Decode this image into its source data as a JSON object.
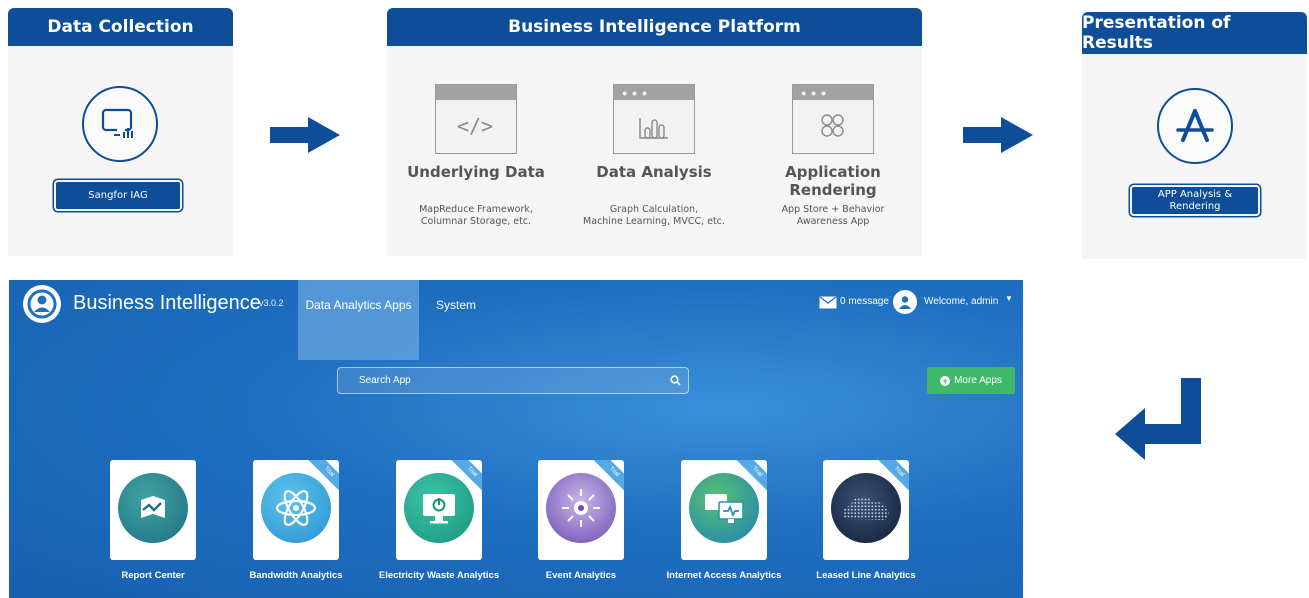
{
  "collection": {
    "title": "Data Collection",
    "button": "Sangfor IAG"
  },
  "platform": {
    "title": "Business Intelligence Platform",
    "columns": [
      {
        "title": "Underlying Data",
        "desc1": "MapReduce Framework,",
        "desc2": "Columnar Storage, etc.",
        "icon": "code-window-icon"
      },
      {
        "title": "Data Analysis",
        "desc1": "Graph Calculation,",
        "desc2": "Machine Learning, MVCC, etc.",
        "icon": "chart-window-icon"
      },
      {
        "title": "Application Rendering",
        "desc1": "App Store + Behavior",
        "desc2": "Awareness App",
        "icon": "apps-window-icon"
      }
    ]
  },
  "presentation": {
    "title": "Presentation of Results",
    "button_line1": "APP Analysis &",
    "button_line2": "Rendering"
  },
  "app": {
    "brand": "Business Intelligence",
    "version": "v3.0.2",
    "nav": [
      "Data Analytics Apps",
      "System"
    ],
    "messages": "0 message",
    "welcome": "Welcome, admin",
    "search_placeholder": "Search App",
    "more_apps": "More Apps",
    "ribbon": "Trial",
    "tiles": [
      {
        "label": "Report Center",
        "icon": "report-icon",
        "trial": false
      },
      {
        "label": "Bandwidth Analytics",
        "icon": "atom-icon",
        "trial": true
      },
      {
        "label": "Electricity Waste Analytics",
        "icon": "power-monitor-icon",
        "trial": true
      },
      {
        "label": "Event Analytics",
        "icon": "event-icon",
        "trial": true
      },
      {
        "label": "Internet Access Analytics",
        "icon": "monitors-icon",
        "trial": true
      },
      {
        "label": "Leased Line Analytics",
        "icon": "cloud-dots-icon",
        "trial": true
      }
    ]
  },
  "colors": {
    "brand_blue": "#0e4d97",
    "app_blue": "#1f6fc0",
    "green": "#3fb86a"
  }
}
